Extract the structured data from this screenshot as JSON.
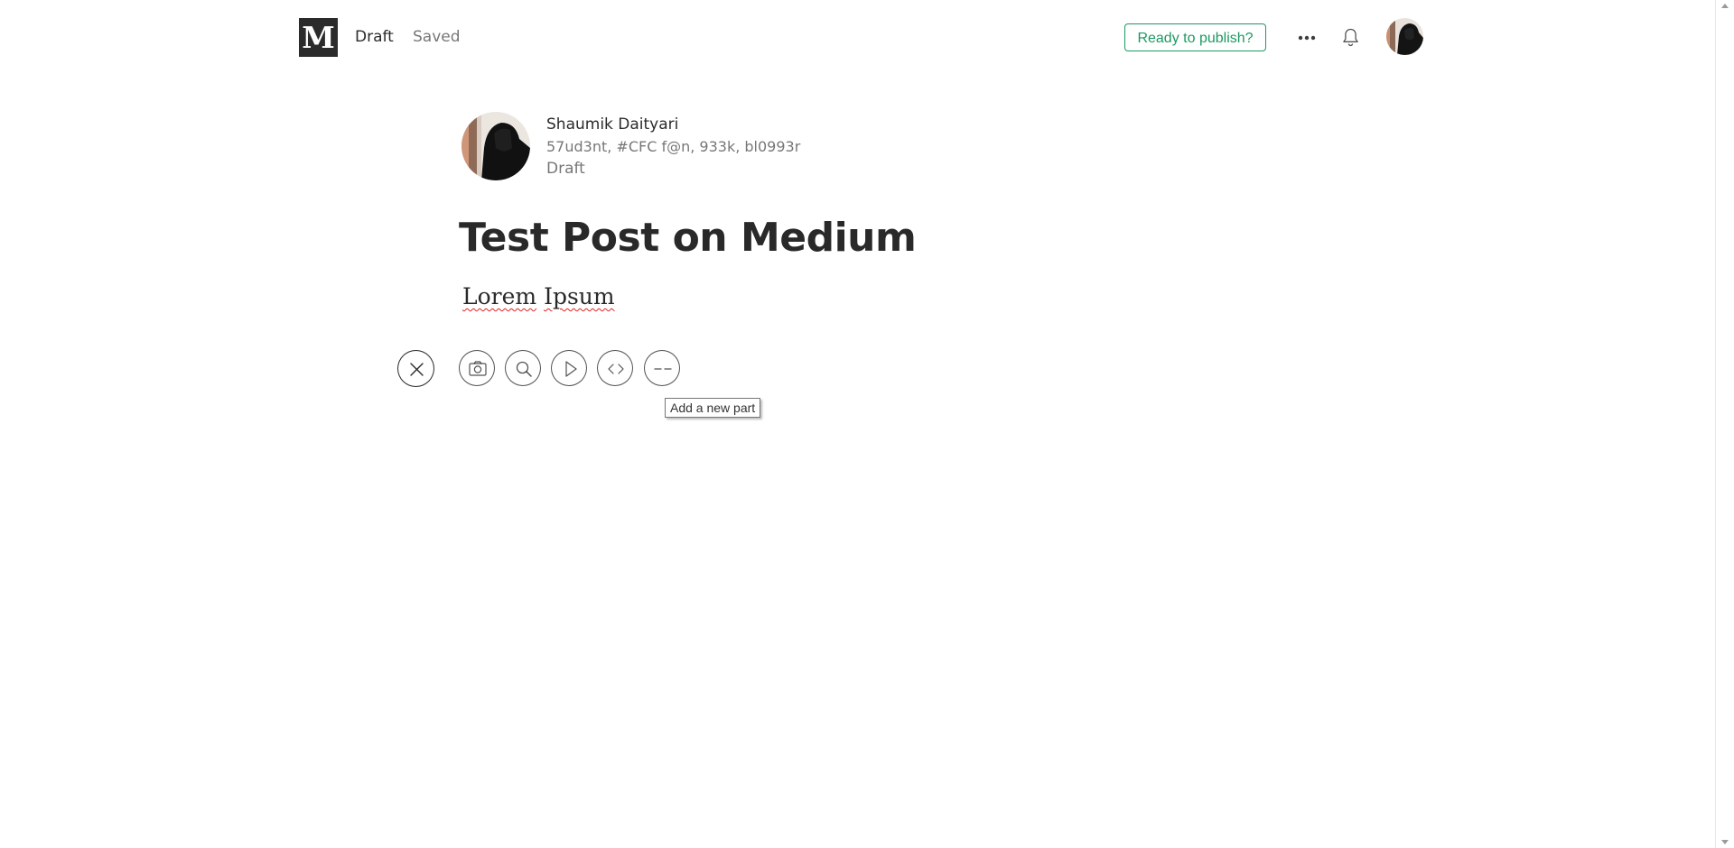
{
  "header": {
    "logo_letter": "M",
    "status": "Draft",
    "save_state": "Saved",
    "publish_label": "Ready to publish?",
    "accent_color": "#1c9963",
    "icons": [
      "more-icon",
      "bell-icon",
      "avatar"
    ]
  },
  "author": {
    "name": "Shaumik Daityari",
    "bio": "57ud3nt, #CFC f@n, 933k, bl0993r",
    "status": "Draft"
  },
  "post": {
    "title": "Test Post on Medium",
    "body_word_1": "Lorem",
    "body_word_2": "Ipsum"
  },
  "toolbar": {
    "buttons": [
      "close-icon",
      "camera-icon",
      "search-icon",
      "video-icon",
      "embed-icon",
      "new-part-icon"
    ],
    "tooltip": "Add a new part"
  }
}
